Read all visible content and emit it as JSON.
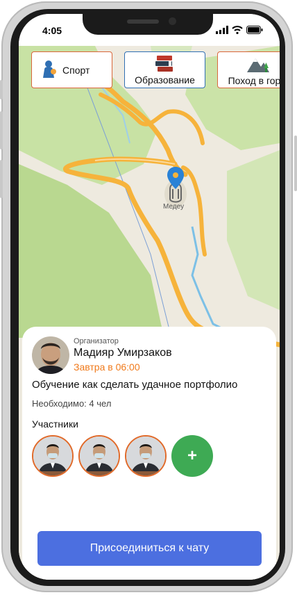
{
  "status": {
    "time": "4:05"
  },
  "categories": [
    {
      "label": "Спорт",
      "icon": "athlete-icon",
      "active": false
    },
    {
      "label": "Образование",
      "icon": "books-icon",
      "active": true
    },
    {
      "label": "Поход в горы",
      "icon": "mountain-icon",
      "active": false
    }
  ],
  "map": {
    "place_label": "Медеу"
  },
  "event": {
    "organizer_role": "Организатор",
    "organizer_name": "Мадияр Умирзаков",
    "when": "Завтра в 06:00",
    "title": "Обучение как сделать удачное портфолио",
    "need_label": "Необходимо:",
    "need_value": "4 чел",
    "participants_header": "Участники",
    "add_label": "+",
    "join_label": "Присоединиться к чату"
  },
  "colors": {
    "accent_orange": "#f07a1b",
    "join_blue": "#4c6fe0",
    "add_green": "#3eaa54"
  }
}
